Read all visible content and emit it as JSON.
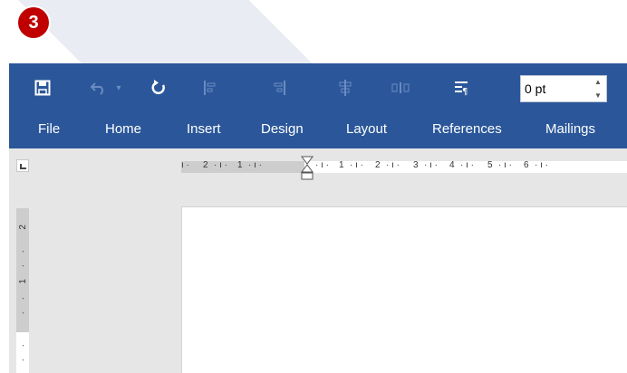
{
  "step_badge": "3",
  "toolbar": {
    "save_icon": "save-icon",
    "undo_icon": "undo-icon",
    "redo_icon": "repeat-icon",
    "spacing_value": "0 pt"
  },
  "tabs": [
    "File",
    "Home",
    "Insert",
    "Design",
    "Layout",
    "References",
    "Mailings"
  ],
  "ruler": {
    "horizontal_labels": [
      "2",
      "1",
      "1",
      "2",
      "3",
      "4",
      "5",
      "6"
    ],
    "vertical_labels": [
      "2",
      "1"
    ]
  },
  "colors": {
    "ribbon": "#2b579a",
    "badge": "#c00000",
    "workspace": "#e6e6e6"
  }
}
